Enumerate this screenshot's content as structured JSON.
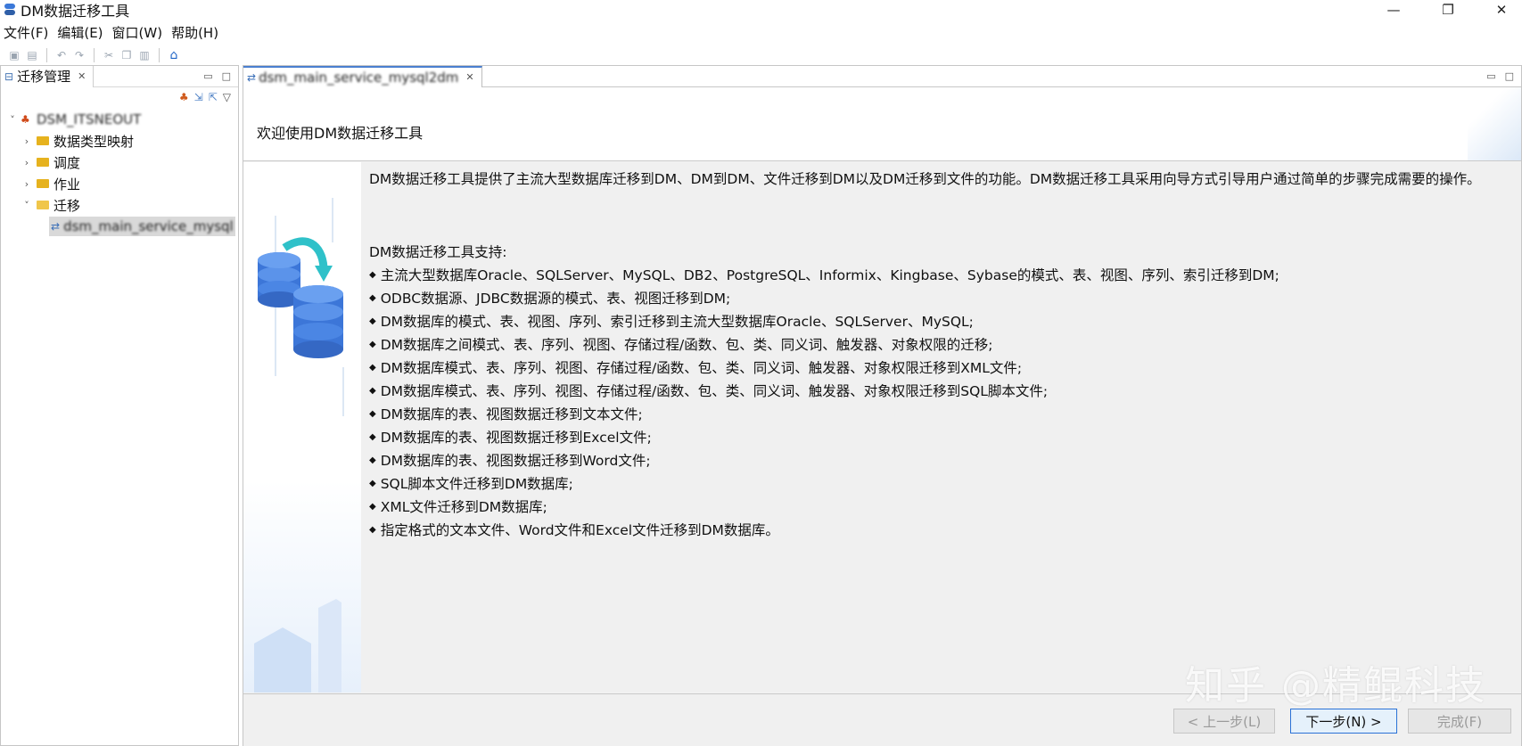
{
  "window": {
    "title": "DM数据迁移工具",
    "controls": {
      "minimize": "—",
      "restore": "❐",
      "close": "✕"
    }
  },
  "menu": {
    "items": [
      "文件(F)",
      "编辑(E)",
      "窗口(W)",
      "帮助(H)"
    ]
  },
  "left_panel": {
    "tab_label": "迁移管理",
    "tab_close": "✕",
    "tree": {
      "root": "DSM_ITSNEOUT",
      "children": [
        {
          "label": "数据类型映射"
        },
        {
          "label": "调度"
        },
        {
          "label": "作业"
        },
        {
          "label": "迁移",
          "children": [
            {
              "label": "dsm_main_service_mysql"
            }
          ]
        }
      ]
    }
  },
  "editor": {
    "tab_label": "dsm_main_service_mysql2dm",
    "tab_close": "✕",
    "header_title": "欢迎使用DM数据迁移工具",
    "intro": "DM数据迁移工具提供了主流大型数据库迁移到DM、DM到DM、文件迁移到DM以及DM迁移到文件的功能。DM数据迁移工具采用向导方式引导用户通过简单的步骤完成需要的操作。",
    "support_heading": "DM数据迁移工具支持:",
    "bullet_glyph": "◆",
    "features": [
      "主流大型数据库Oracle、SQLServer、MySQL、DB2、PostgreSQL、Informix、Kingbase、Sybase的模式、表、视图、序列、索引迁移到DM;",
      "ODBC数据源、JDBC数据源的模式、表、视图迁移到DM;",
      "DM数据库的模式、表、视图、序列、索引迁移到主流大型数据库Oracle、SQLServer、MySQL;",
      "DM数据库之间模式、表、序列、视图、存储过程/函数、包、类、同义词、触发器、对象权限的迁移;",
      "DM数据库模式、表、序列、视图、存储过程/函数、包、类、同义词、触发器、对象权限迁移到XML文件;",
      "DM数据库模式、表、序列、视图、存储过程/函数、包、类、同义词、触发器、对象权限迁移到SQL脚本文件;",
      "DM数据库的表、视图数据迁移到文本文件;",
      "DM数据库的表、视图数据迁移到Excel文件;",
      "DM数据库的表、视图数据迁移到Word文件;",
      "SQL脚本文件迁移到DM数据库;",
      "XML文件迁移到DM数据库;",
      "指定格式的文本文件、Word文件和Excel文件迁移到DM数据库。"
    ],
    "buttons": {
      "back": "< 上一步(L)",
      "next": "下一步(N) >",
      "finish": "完成(F)"
    }
  },
  "watermark": "知乎 @精鲲科技"
}
